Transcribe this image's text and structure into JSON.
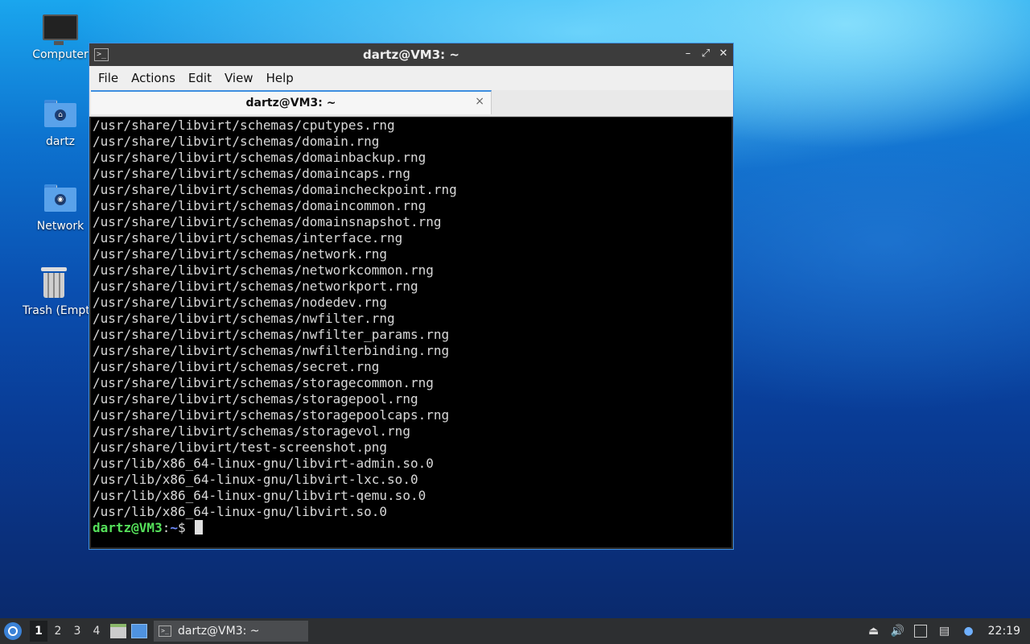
{
  "desktop": {
    "icons": [
      {
        "label": "Computer",
        "icon": "computer-icon"
      },
      {
        "label": "dartz",
        "icon": "home-folder-icon"
      },
      {
        "label": "Network",
        "icon": "network-folder-icon"
      },
      {
        "label": "Trash (Empty)",
        "icon": "trash-icon"
      }
    ]
  },
  "window": {
    "title": "dartz@VM3: ~",
    "controls": {
      "minimize": "–",
      "maximize": "⤢",
      "close": "✕"
    },
    "menu": [
      "File",
      "Actions",
      "Edit",
      "View",
      "Help"
    ],
    "tab": {
      "label": "dartz@VM3: ~",
      "close": "×"
    },
    "terminal": {
      "lines": [
        "/usr/share/libvirt/schemas/cputypes.rng",
        "/usr/share/libvirt/schemas/domain.rng",
        "/usr/share/libvirt/schemas/domainbackup.rng",
        "/usr/share/libvirt/schemas/domaincaps.rng",
        "/usr/share/libvirt/schemas/domaincheckpoint.rng",
        "/usr/share/libvirt/schemas/domaincommon.rng",
        "/usr/share/libvirt/schemas/domainsnapshot.rng",
        "/usr/share/libvirt/schemas/interface.rng",
        "/usr/share/libvirt/schemas/network.rng",
        "/usr/share/libvirt/schemas/networkcommon.rng",
        "/usr/share/libvirt/schemas/networkport.rng",
        "/usr/share/libvirt/schemas/nodedev.rng",
        "/usr/share/libvirt/schemas/nwfilter.rng",
        "/usr/share/libvirt/schemas/nwfilter_params.rng",
        "/usr/share/libvirt/schemas/nwfilterbinding.rng",
        "/usr/share/libvirt/schemas/secret.rng",
        "/usr/share/libvirt/schemas/storagecommon.rng",
        "/usr/share/libvirt/schemas/storagepool.rng",
        "/usr/share/libvirt/schemas/storagepoolcaps.rng",
        "/usr/share/libvirt/schemas/storagevol.rng",
        "/usr/share/libvirt/test-screenshot.png",
        "/usr/lib/x86_64-linux-gnu/libvirt-admin.so.0",
        "/usr/lib/x86_64-linux-gnu/libvirt-lxc.so.0",
        "/usr/lib/x86_64-linux-gnu/libvirt-qemu.so.0",
        "/usr/lib/x86_64-linux-gnu/libvirt.so.0"
      ],
      "prompt": {
        "user_host": "dartz@VM3",
        "sep": ":",
        "path": "~",
        "symbol": "$ "
      }
    }
  },
  "taskbar": {
    "workspaces": [
      "1",
      "2",
      "3",
      "4"
    ],
    "active_workspace": "1",
    "task_label": "dartz@VM3: ~",
    "clock": "22:19",
    "tray_icons": [
      "eject-icon",
      "volume-icon",
      "network-icon",
      "clipboard-icon",
      "notification-icon"
    ]
  },
  "colors": {
    "accent": "#3d8ee0",
    "prompt_user": "#55e05a",
    "prompt_path": "#6f8cff"
  }
}
